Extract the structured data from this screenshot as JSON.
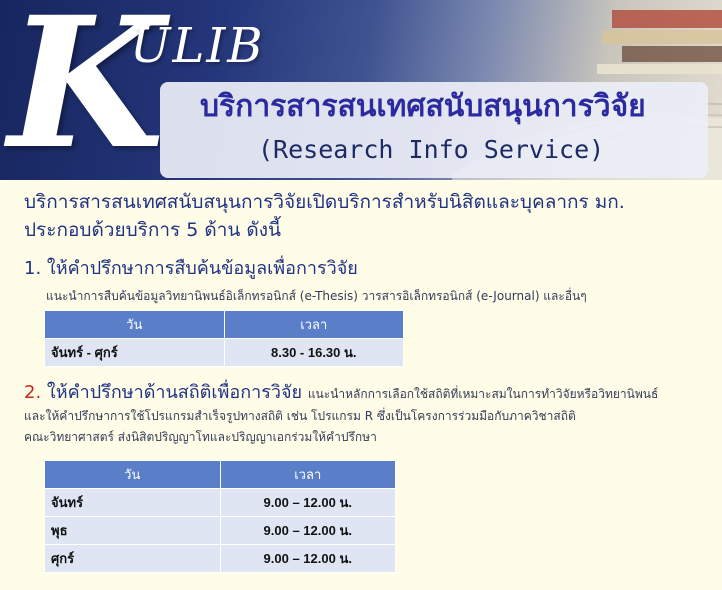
{
  "banner": {
    "logo_k": "K",
    "logo_ulib": "ULIB",
    "title_thai": "บริการสารสนเทศสนับสนุนการวิจัย",
    "title_eng": "(Research Info Service)"
  },
  "intro": {
    "line1": "บริการสารสนเทศสนับสนุนการวิจัยเปิดบริการสำหรับนิสิตและบุคลากร มก.",
    "line2": "ประกอบด้วยบริการ 5 ด้าน ดังนี้"
  },
  "section1": {
    "number": "1.",
    "heading": "ให้คำปรึกษาการสืบค้นข้อมูลเพื่อการวิจัย",
    "description": "แนะนำการสืบค้นข้อมูลวิทยานิพนธ์อิเล็กทรอนิกส์ (e-Thesis) วารสารอิเล็กทรอนิกส์ (e-Journal) และอื่นๆ",
    "table": {
      "headers": [
        "วัน",
        "เวลา"
      ],
      "rows": [
        {
          "day": "จันทร์ - ศุกร์",
          "time": "8.30 - 16.30 น."
        }
      ]
    }
  },
  "section2": {
    "number": "2.",
    "heading": "ให้คำปรึกษาด้านสถิติเพื่อการวิจัย",
    "desc_inline": "แนะนำหลักการเลือกใช้สถิติที่เหมาะสมในการทำวิจัยหรือวิทยานิพนธ์",
    "desc_line2": "และให้คำปรึกษาการใช้โปรแกรมสำเร็จรูปทางสถิติ เช่น โปรแกรม R ซึ่งเป็นโครงการร่วมมือกับภาควิชาสถิติ",
    "desc_line3": "คณะวิทยาศาสตร์ ส่งนิสิตปริญญาโทและปริญญาเอกร่วมให้คำปรึกษา",
    "table": {
      "headers": [
        "วัน",
        "เวลา"
      ],
      "rows": [
        {
          "day": "จันทร์",
          "time": "9.00 – 12.00 น."
        },
        {
          "day": "พุธ",
          "time": "9.00 – 12.00 น."
        },
        {
          "day": "ศุกร์",
          "time": "9.00 – 12.00 น."
        }
      ]
    }
  },
  "colors": {
    "banner_navy": "#17265f",
    "title_purple": "#2b2aa0",
    "heading_blue": "#1f3384",
    "number_red": "#c8261c",
    "table_header": "#5b7ec8",
    "table_cell": "#dfe5f3",
    "page_bg": "#fffce8"
  }
}
